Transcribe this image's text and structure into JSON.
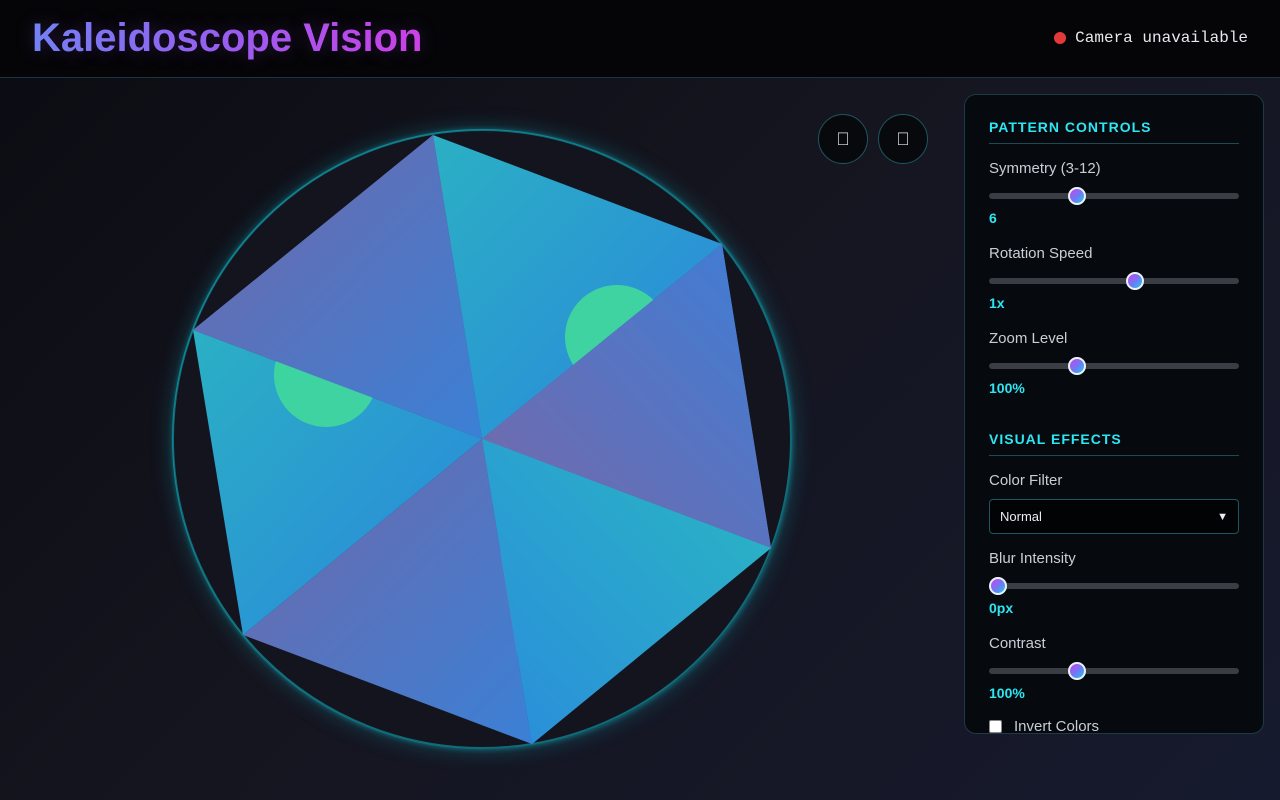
{
  "header": {
    "title": "Kaleidoscope Vision",
    "status_text": "Camera unavailable",
    "status_color": "#e23a3a"
  },
  "stage": {
    "buttons": [
      {
        "name": "capture-button",
        "icon": "camera-icon"
      },
      {
        "name": "fullscreen-button",
        "icon": "fullscreen-icon"
      }
    ],
    "button_glyph": ""
  },
  "panel": {
    "pattern_title": "PATTERN CONTROLS",
    "effects_title": "VISUAL EFFECTS",
    "symmetry": {
      "label": "Symmetry (3-12)",
      "value": "6",
      "fraction": 0.34
    },
    "rotation": {
      "label": "Rotation Speed",
      "value": "1x",
      "fraction": 0.59
    },
    "zoom": {
      "label": "Zoom Level",
      "value": "100%",
      "fraction": 0.34
    },
    "color_filter": {
      "label": "Color Filter",
      "selected": "Normal"
    },
    "blur": {
      "label": "Blur Intensity",
      "value": "0px",
      "fraction": 0.0
    },
    "contrast": {
      "label": "Contrast",
      "value": "100%",
      "fraction": 0.34
    },
    "invert": {
      "label": "Invert Colors",
      "checked": false
    }
  },
  "colors": {
    "accent": "#2ee6f2",
    "title_gradient_start": "#6f86f5",
    "title_gradient_end": "#d23fe8",
    "wedge_purple": "#6b6fae",
    "wedge_blue": "#2a8fd8",
    "wedge_teal": "#2bb5c0",
    "blob_green": "#3fd69e"
  }
}
